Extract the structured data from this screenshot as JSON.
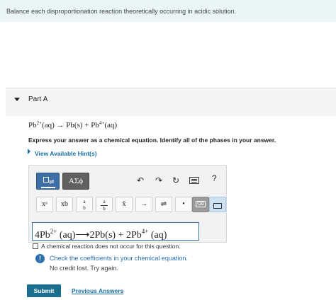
{
  "banner": {
    "text": "Balance each disproportionation reaction theoretically occurring in acidic solution."
  },
  "part": {
    "label": "Part A"
  },
  "reaction": {
    "pb": "Pb",
    "pb_charge": "2+",
    "reactant_state": "(aq)",
    "arrow": "→",
    "product1": "Pb(s)",
    "plus": "+",
    "pb2": "Pb",
    "pb2_charge": "4+",
    "product2_state": "(aq)"
  },
  "instructions": "Express your answer as a chemical equation. Identify all of the phases in your answer.",
  "hints": {
    "label": "View Available Hint(s)"
  },
  "toolbar": {
    "symbols_label": "ΑΣϕ",
    "undo": "↶",
    "redo": "↷",
    "reset": "↻",
    "help": "?"
  },
  "keys": {
    "superscript": "xᵃ",
    "subscript": "xb",
    "fraction_label": "a/b",
    "xbar": "x̄",
    "arrow": "→",
    "equilibrium": "⇌",
    "dot": "•",
    "backspace": "⌫"
  },
  "answer": {
    "coef1": "4Pb",
    "charge1": "2+",
    "state1": "(aq)",
    "arrow": "⟶",
    "product1": "2Pb(s)",
    "plus": "+",
    "product2": "2Pb",
    "charge2": "4+",
    "state2": "(aq)"
  },
  "no_reaction": {
    "label": "A chemical reaction does not occur for this question."
  },
  "feedback": {
    "icon": "!",
    "message": "Check the coefficients in your chemical equation.",
    "sub": "No credit lost. Try again."
  },
  "actions": {
    "submit": "Submit",
    "previous": "Previous Answers"
  },
  "colors": {
    "accent": "#1a6fa6",
    "submit_bg": "#1b6e8e",
    "banner_bg": "#eaf5f6",
    "template_btn": "#3d6ea8"
  }
}
